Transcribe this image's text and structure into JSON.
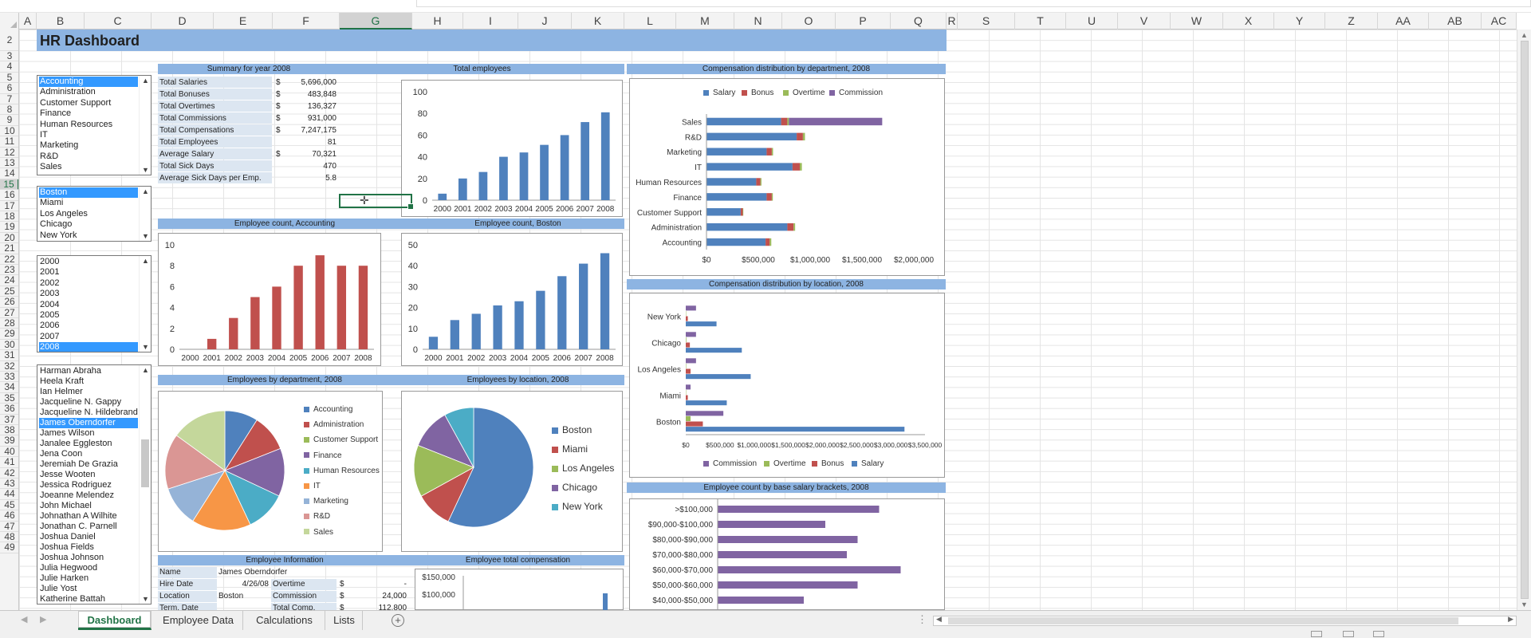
{
  "columns": [
    "A",
    "B",
    "C",
    "D",
    "E",
    "F",
    "G",
    "H",
    "I",
    "J",
    "K",
    "L",
    "M",
    "N",
    "O",
    "P",
    "Q",
    "R",
    "S",
    "T",
    "U",
    "V",
    "W",
    "X",
    "Y",
    "Z",
    "AA",
    "AB",
    "AC"
  ],
  "rows": [
    "2",
    "3",
    "4",
    "5",
    "6",
    "7",
    "8",
    "9",
    "10",
    "11",
    "12",
    "13",
    "14",
    "15",
    "16",
    "17",
    "18",
    "19",
    "20",
    "21",
    "22",
    "23",
    "24",
    "25",
    "26",
    "27",
    "28",
    "29",
    "30",
    "31",
    "32",
    "33",
    "34",
    "35",
    "36",
    "37",
    "38",
    "39",
    "40",
    "41",
    "42",
    "43",
    "44",
    "45",
    "46",
    "47",
    "48",
    "49"
  ],
  "dashboard_title": "HR Dashboard",
  "lists": {
    "departments": [
      "Accounting",
      "Administration",
      "Customer Support",
      "Finance",
      "Human Resources",
      "IT",
      "Marketing",
      "R&D",
      "Sales"
    ],
    "locations": [
      "Boston",
      "Miami",
      "Los Angeles",
      "Chicago",
      "New York"
    ],
    "years": [
      "2000",
      "2001",
      "2002",
      "2003",
      "2004",
      "2005",
      "2006",
      "2007",
      "2008"
    ],
    "employees": [
      "Harman Abraha",
      "Heela Kraft",
      "Ian Helmer",
      "Jacqueline N. Gappy",
      "Jacqueline N. Hildebrand",
      "James Oberndorfer",
      "James Wilson",
      "Janalee Eggleston",
      "Jena Coon",
      "Jeremiah De Grazia",
      "Jesse Wooten",
      "Jessica Rodriguez",
      "Joeanne Melendez",
      "John  Michael",
      "Johnathan A Wilhite",
      "Jonathan C. Parnell",
      "Joshua Daniel",
      "Joshua Fields",
      "Joshua Johnson",
      "Julia  Hegwood",
      "Julie Harken",
      "Julie Yost",
      "Katherine Battah"
    ]
  },
  "summary": {
    "title": "Summary for year 2008",
    "rows": [
      {
        "label": "Total Salaries",
        "cur": "$",
        "value": "5,696,000"
      },
      {
        "label": "Total Bonuses",
        "cur": "$",
        "value": "483,848"
      },
      {
        "label": "Total Overtimes",
        "cur": "$",
        "value": "136,327"
      },
      {
        "label": "Total Commissions",
        "cur": "$",
        "value": "931,000"
      },
      {
        "label": "Total Compensations",
        "cur": "$",
        "value": "7,247,175"
      },
      {
        "label": "Total Employees",
        "cur": "",
        "value": "81"
      },
      {
        "label": "Average Salary",
        "cur": "$",
        "value": "70,321"
      },
      {
        "label": "Total Sick Days",
        "cur": "",
        "value": "470"
      },
      {
        "label": "Average Sick Days per Emp.",
        "cur": "",
        "value": "5.8"
      }
    ]
  },
  "section_titles": {
    "total_employees": "Total employees",
    "comp_by_dept": "Compensation distribution by department, 2008",
    "count_accounting": "Employee count, Accounting",
    "count_boston": "Employee count, Boston",
    "comp_by_location": "Compensation distribution by location, 2008",
    "by_dept_pie": "Employees by department, 2008",
    "by_loc_pie": "Employees by location, 2008",
    "salary_brackets": "Employee count by base salary brackets, 2008",
    "emp_info": "Employee Information",
    "emp_total_comp": "Employee total compensation"
  },
  "employee_info": {
    "name_label": "Name",
    "name": "James Oberndorfer",
    "hire_label": "Hire Date",
    "hire": "4/26/08",
    "overtime_label": "Overtime",
    "overtime_cur": "$",
    "overtime": "-",
    "location_label": "Location",
    "location": "Boston",
    "commission_label": "Commission",
    "commission_cur": "$",
    "commission": "24,000",
    "term_label": "Term. Date",
    "total_label": "Total Comp.",
    "total_cur": "$",
    "total": "112,800"
  },
  "chart_data": [
    {
      "type": "bar",
      "id": "total_employees",
      "categories": [
        "2000",
        "2001",
        "2002",
        "2003",
        "2004",
        "2005",
        "2006",
        "2007",
        "2008"
      ],
      "values": [
        6,
        20,
        26,
        40,
        44,
        51,
        60,
        72,
        81
      ],
      "ylim": [
        0,
        100
      ],
      "yticks": [
        "0",
        "20",
        "40",
        "60",
        "80",
        "100"
      ],
      "color": "#4f81bd"
    },
    {
      "type": "bar",
      "id": "count_accounting",
      "categories": [
        "2000",
        "2001",
        "2002",
        "2003",
        "2004",
        "2005",
        "2006",
        "2007",
        "2008"
      ],
      "values": [
        0,
        1,
        3,
        5,
        6,
        8,
        9,
        8,
        8
      ],
      "ylim": [
        0,
        10
      ],
      "yticks": [
        "0",
        "2",
        "4",
        "6",
        "8",
        "10"
      ],
      "color": "#c0504d"
    },
    {
      "type": "bar",
      "id": "count_boston",
      "categories": [
        "2000",
        "2001",
        "2002",
        "2003",
        "2004",
        "2005",
        "2006",
        "2007",
        "2008"
      ],
      "values": [
        6,
        14,
        17,
        21,
        23,
        28,
        35,
        41,
        46
      ],
      "ylim": [
        0,
        50
      ],
      "yticks": [
        "0",
        "10",
        "20",
        "30",
        "40",
        "50"
      ],
      "color": "#4f81bd"
    },
    {
      "type": "bar",
      "orientation": "horizontal",
      "stacked": true,
      "id": "comp_by_dept",
      "categories": [
        "Sales",
        "R&D",
        "Marketing",
        "IT",
        "Human Resources",
        "Finance",
        "Customer Support",
        "Administration",
        "Accounting"
      ],
      "series": [
        {
          "name": "Salary",
          "color": "#4f81bd",
          "values": [
            720000,
            870000,
            580000,
            830000,
            480000,
            580000,
            330000,
            780000,
            570000
          ]
        },
        {
          "name": "Bonus",
          "color": "#c0504d",
          "values": [
            60000,
            60000,
            50000,
            70000,
            40000,
            50000,
            20000,
            60000,
            40000
          ]
        },
        {
          "name": "Overtime",
          "color": "#9bbb59",
          "values": [
            15000,
            20000,
            12000,
            20000,
            10000,
            10000,
            5000,
            15000,
            15000
          ]
        },
        {
          "name": "Commission",
          "color": "#8064a2",
          "values": [
            900000,
            0,
            0,
            0,
            0,
            0,
            0,
            0,
            0
          ]
        }
      ],
      "xlim": [
        0,
        2000000
      ],
      "xticks": [
        "$0",
        "$500,000",
        "$1,000,000",
        "$1,500,000",
        "$2,000,000"
      ]
    },
    {
      "type": "bar",
      "orientation": "horizontal",
      "id": "comp_by_location",
      "categories": [
        "New York",
        "Chicago",
        "Los Angeles",
        "Miami",
        "Boston"
      ],
      "series": [
        {
          "name": "Commission",
          "color": "#8064a2",
          "values": [
            150000,
            150000,
            150000,
            70000,
            550000
          ]
        },
        {
          "name": "Overtime",
          "color": "#9bbb59",
          "values": [
            5000,
            8000,
            6000,
            5000,
            70000
          ]
        },
        {
          "name": "Bonus",
          "color": "#c0504d",
          "values": [
            30000,
            60000,
            70000,
            30000,
            250000
          ]
        },
        {
          "name": "Salary",
          "color": "#4f81bd",
          "values": [
            450000,
            820000,
            950000,
            600000,
            3200000
          ]
        }
      ],
      "xlim": [
        0,
        3500000
      ],
      "xticks": [
        "$0",
        "$500,000",
        "$1,000,000",
        "$1,500,000",
        "$2,000,000",
        "$2,500,000",
        "$3,000,000",
        "$3,500,000"
      ]
    },
    {
      "type": "pie",
      "id": "by_dept_pie",
      "categories": [
        "Accounting",
        "Administration",
        "Customer Support",
        "Finance",
        "Human Resources",
        "IT",
        "Marketing",
        "R&D",
        "Sales"
      ],
      "values": [
        9,
        10,
        0,
        13,
        11,
        16,
        11,
        15,
        15
      ],
      "colors": [
        "#4f81bd",
        "#c0504d",
        "#9bbb59",
        "#8064a2",
        "#4bacc6",
        "#f79646",
        "#95b3d7",
        "#da9694",
        "#c4d79b"
      ]
    },
    {
      "type": "pie",
      "id": "by_loc_pie",
      "categories": [
        "Boston",
        "Miami",
        "Los Angeles",
        "Chicago",
        "New York"
      ],
      "values": [
        57,
        10,
        14,
        11,
        8
      ],
      "colors": [
        "#4f81bd",
        "#c0504d",
        "#9bbb59",
        "#8064a2",
        "#4bacc6"
      ]
    },
    {
      "type": "bar",
      "orientation": "horizontal",
      "id": "salary_brackets",
      "categories": [
        ">$100,000",
        "$90,000-$100,000",
        "$80,000-$90,000",
        "$70,000-$80,000",
        "$60,000-$70,000",
        "$50,000-$60,000",
        "$40,000-$50,000"
      ],
      "values": [
        15,
        10,
        13,
        12,
        17,
        13,
        8
      ],
      "xlim": [
        0,
        20
      ],
      "color": "#8064a2"
    },
    {
      "type": "bar",
      "id": "emp_total_comp",
      "yticks": [
        "$150,000",
        "$100,000"
      ],
      "ylim": [
        0,
        150000
      ],
      "values": [
        112800
      ],
      "color": "#4f81bd"
    }
  ],
  "sheet_tabs": [
    "Dashboard",
    "Employee Data",
    "Calculations",
    "Lists"
  ]
}
